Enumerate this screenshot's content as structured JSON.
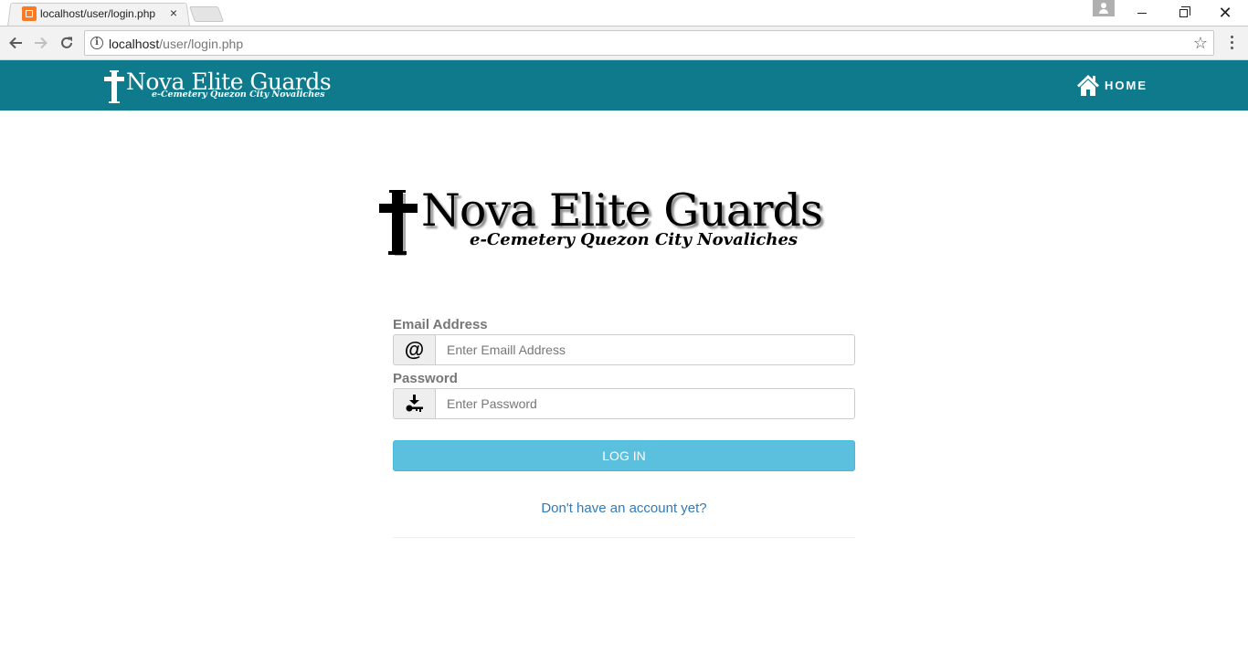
{
  "browser": {
    "tab_title": "localhost/user/login.php",
    "tab_close": "×",
    "url_host": "localhost",
    "url_path": "/user/login.php",
    "win_close": "✕"
  },
  "navbar": {
    "brand_title": "Nova Elite Guards",
    "brand_subtitle": "e-Cemetery Quezon City Novaliches",
    "home_label": "HOME",
    "background": "#0e7a8c"
  },
  "logo": {
    "title": "Nova Elite Guards",
    "subtitle": "e-Cemetery Quezon City Novaliches"
  },
  "form": {
    "email_label": "Email Address",
    "email_icon": "@",
    "email_placeholder": "Enter Emaill Address",
    "email_value": "",
    "password_label": "Password",
    "password_icon": "key-icon",
    "password_placeholder": "Enter Password",
    "password_value": "",
    "login_label": "LOG IN",
    "login_color": "#5bc0de",
    "signup_link": "Don't have an account yet?"
  }
}
